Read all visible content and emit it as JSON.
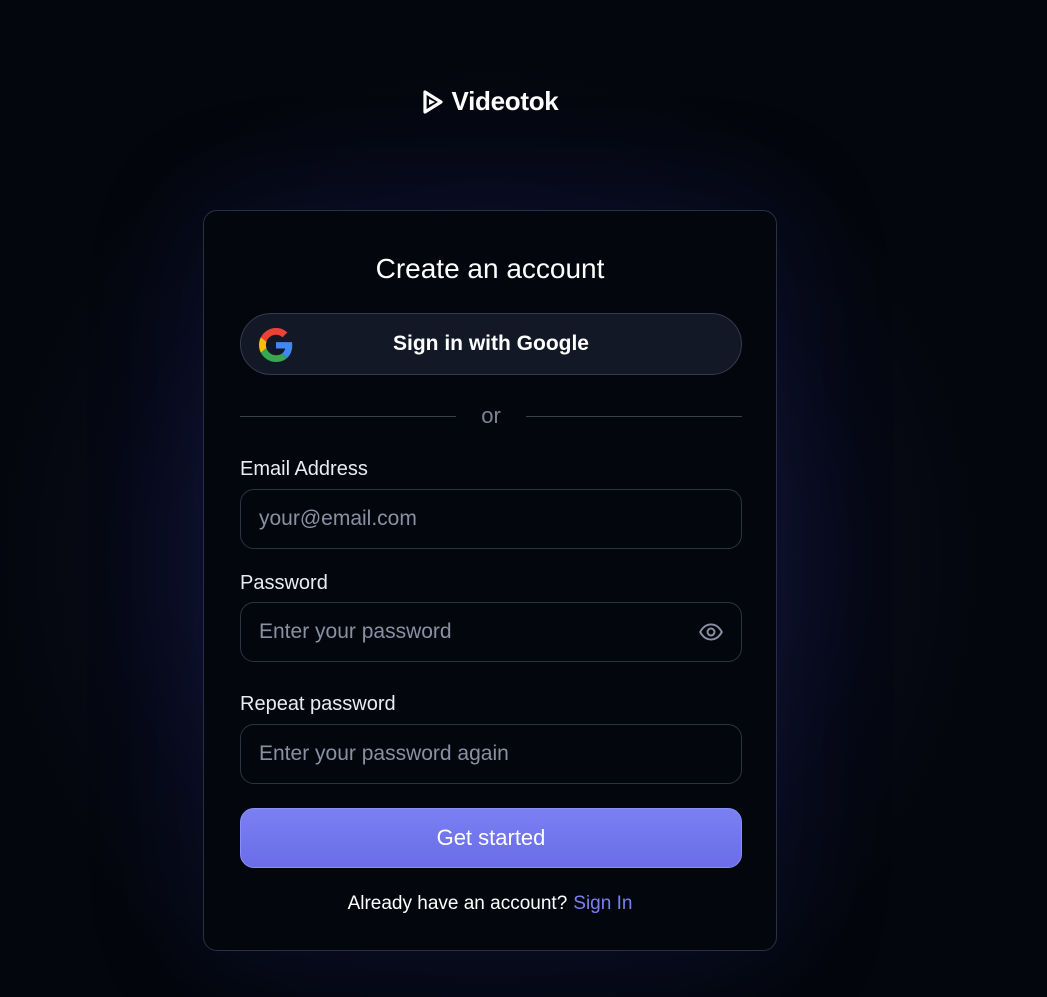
{
  "brand": {
    "name": "Videotok",
    "icon": "play-logo-icon"
  },
  "card": {
    "title": "Create an account",
    "google_button": {
      "label": "Sign in with Google",
      "icon": "google-icon"
    },
    "divider_text": "or",
    "email": {
      "label": "Email Address",
      "value": "",
      "placeholder": "your@email.com"
    },
    "password": {
      "label": "Password",
      "value": "",
      "placeholder": "Enter your password",
      "toggle_icon": "eye-icon"
    },
    "repeat_password": {
      "label": "Repeat password",
      "value": "",
      "placeholder": "Enter your password again"
    },
    "submit_label": "Get started",
    "footer": {
      "text": "Already have an account?",
      "link": "Sign In"
    }
  },
  "colors": {
    "accent": "#6c70ea",
    "link": "#7b7ff5",
    "background": "#04060d"
  }
}
